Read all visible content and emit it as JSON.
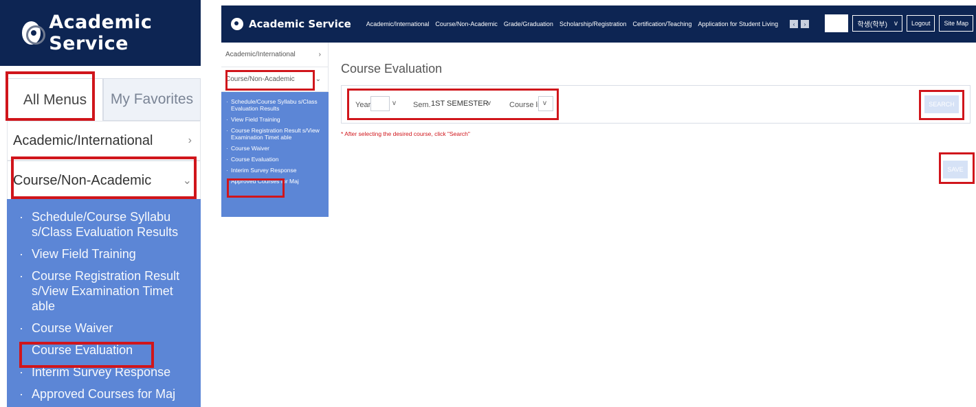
{
  "brand": {
    "title": "Academic Service"
  },
  "zoom": {
    "tabs": {
      "all": "All Menus",
      "favorites": "My Favorites"
    },
    "menu": [
      {
        "label": "Academic/International",
        "chevron": "›"
      },
      {
        "label": "Course/Non-Academic",
        "chevron": "⌄"
      }
    ],
    "submenu": [
      "Schedule/Course Syllabu s/Class Evaluation Results",
      "View Field Training",
      "Course Registration Result s/View Examination Timet able",
      "Course Waiver",
      "Course Evaluation",
      "Interim Survey Response",
      "Approved Courses for Maj"
    ]
  },
  "topbar": {
    "title": "Academic Service",
    "nav": [
      "Academic/International",
      "Course/Non-Academic",
      "Grade/Graduation",
      "Scholarship/Registration",
      "Certification/Teaching",
      "Application for Student Living"
    ],
    "prev": "‹",
    "next": "›",
    "role": "학생(학부)",
    "role_chevron": "v",
    "logout": "Logout",
    "sitemap": "Site Map"
  },
  "sidebar": {
    "items": [
      {
        "label": "Academic/International",
        "chevron": "›"
      },
      {
        "label": "Course/Non-Academic",
        "chevron": "⌄"
      }
    ],
    "sub": [
      "Schedule/Course Syllabu s/Class Evaluation Results",
      "View Field Training",
      "Course Registration Result s/View Examination Timet able",
      "Course Waiver",
      "Course Evaluation",
      "Interim Survey Response",
      "Approved Courses for Maj"
    ]
  },
  "main": {
    "title": "Course Evaluation",
    "filter": {
      "year_label": "Year",
      "year_value": "",
      "sem_label": "Sem.",
      "sem_value": "1ST SEMESTER",
      "course_label": "Course list",
      "course_value": "",
      "chevron": "v"
    },
    "search": "SEARCH",
    "note": "* After selecting the desired course, click \"Search\"",
    "save": "SAVE"
  },
  "colors": {
    "navy": "#0d2553",
    "menu_blue": "#5c86d6",
    "highlight": "#d0151b",
    "button_light": "#d6e2f6"
  }
}
